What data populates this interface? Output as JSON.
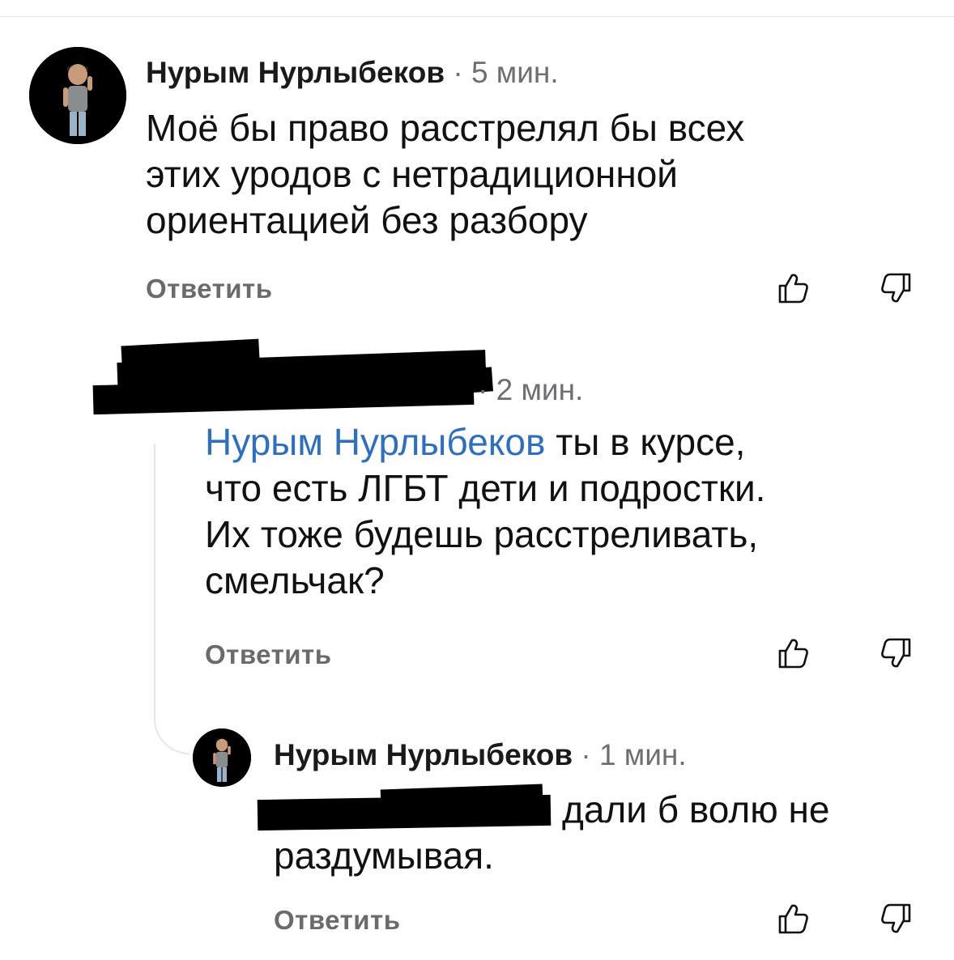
{
  "comments": [
    {
      "author": "Нурым Нурлыбеков",
      "separator": "·",
      "time": "5 мин.",
      "lines": [
        "Моё бы право расстрелял бы всех",
        "этих уродов с нетрадиционной",
        "ориентацией без разбору"
      ],
      "reply_label": "Ответить",
      "like_icon": "thumbs-up-icon",
      "dislike_icon": "thumbs-down-icon"
    },
    {
      "separator": "·",
      "time": "2 мин.",
      "mention": "Нурым Нурлыбеков",
      "lines": [
        " ты в курсе,",
        "что есть ЛГБТ дети и подростки.",
        "Их тоже будешь расстреливать,",
        "смельчак?"
      ],
      "reply_label": "Ответить",
      "like_icon": "thumbs-up-icon",
      "dislike_icon": "thumbs-down-icon"
    },
    {
      "author": "Нурым Нурлыбеков",
      "separator": "·",
      "time": "1 мин.",
      "lines": [
        "дали б волю не",
        "раздумывая."
      ],
      "reply_label": "Ответить",
      "like_icon": "thumbs-up-icon",
      "dislike_icon": "thumbs-down-icon"
    }
  ],
  "colors": {
    "mention": "#2f6fbf",
    "muted": "#6e6e73",
    "thread_line": "#e6e6e6"
  }
}
